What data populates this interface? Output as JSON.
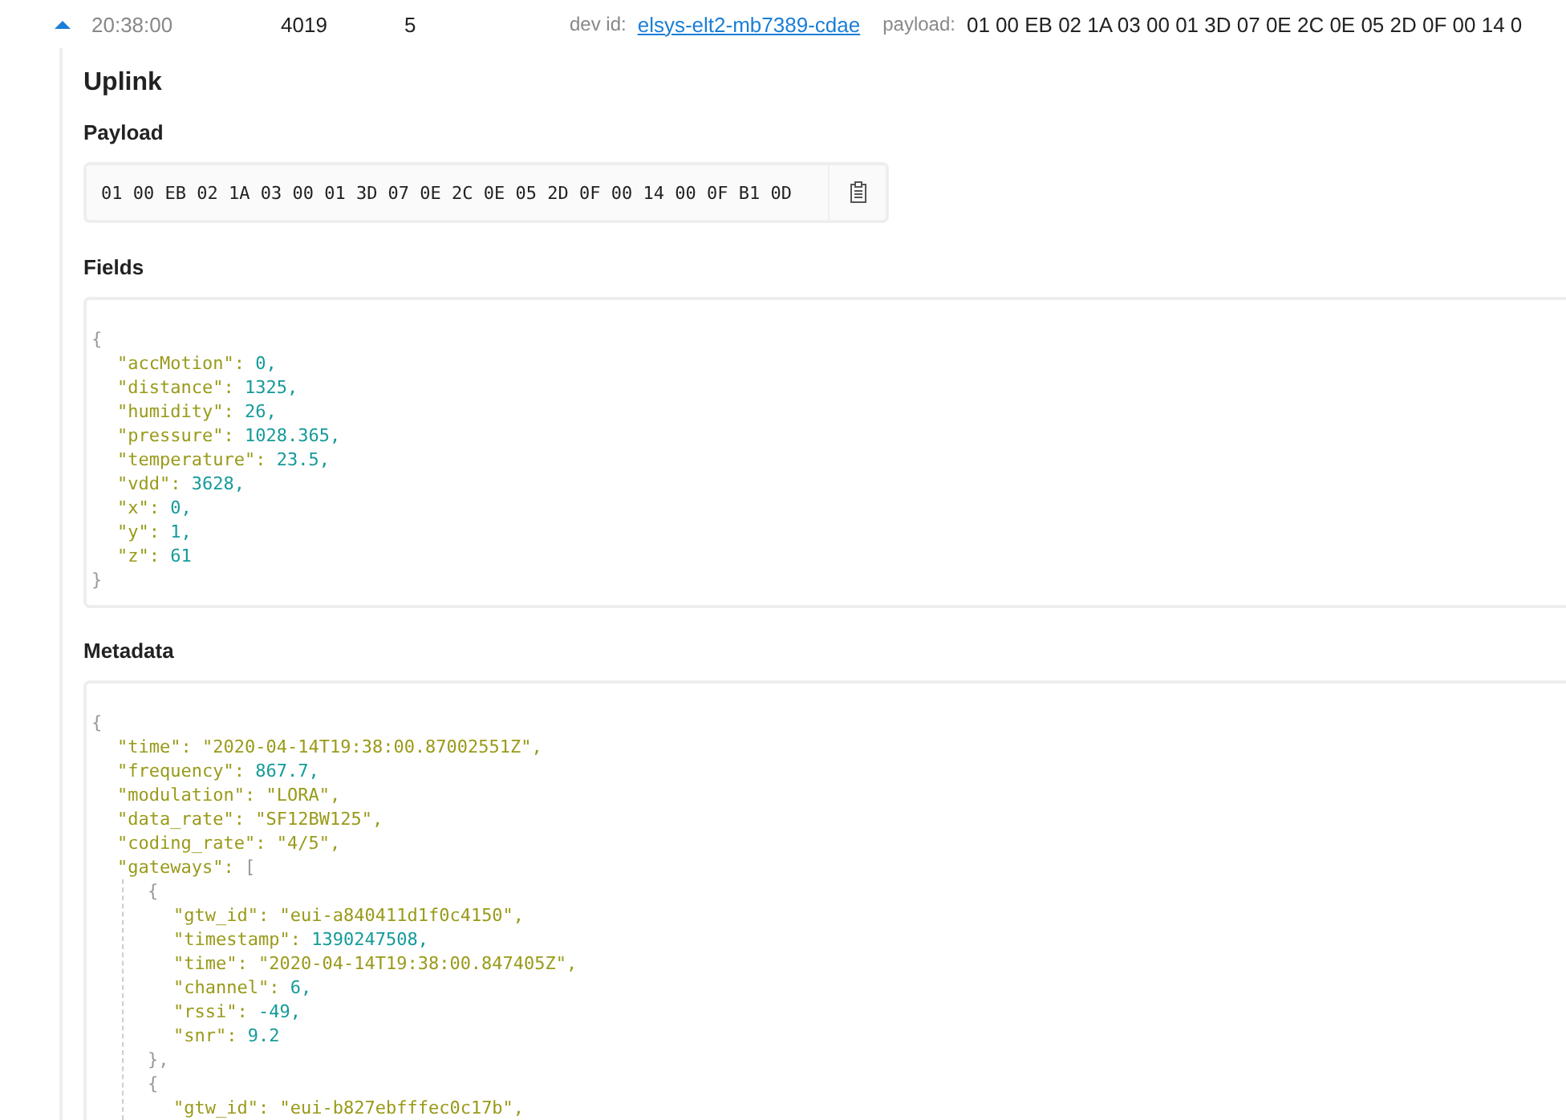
{
  "event": {
    "expanded": true,
    "time": "20:38:00",
    "counter": "4019",
    "port": "5",
    "dev_id_label": "dev id:",
    "dev_id": "elsys-elt2-mb7389-cdae",
    "payload_label": "payload:",
    "payload": "01 00 EB 02 1A 03 00 01 3D 07 0E 2C 0E 05 2D 0F 00 14 0"
  },
  "detail": {
    "title": "Uplink",
    "payload": {
      "label": "Payload",
      "value": "01 00 EB 02 1A 03 00 01 3D 07 0E 2C 0E 05 2D 0F 00 14 00 0F B1 0D"
    },
    "fields": {
      "label": "Fields",
      "json": {
        "open": "{",
        "close": "}",
        "entries": [
          {
            "key": "\"accMotion\":",
            "value": "0,",
            "kind": "number"
          },
          {
            "key": "\"distance\":",
            "value": "1325,",
            "kind": "number"
          },
          {
            "key": "\"humidity\":",
            "value": "26,",
            "kind": "number"
          },
          {
            "key": "\"pressure\":",
            "value": "1028.365,",
            "kind": "number"
          },
          {
            "key": "\"temperature\":",
            "value": "23.5,",
            "kind": "number"
          },
          {
            "key": "\"vdd\":",
            "value": "3628,",
            "kind": "number"
          },
          {
            "key": "\"x\":",
            "value": "0,",
            "kind": "number"
          },
          {
            "key": "\"y\":",
            "value": "1,",
            "kind": "number"
          },
          {
            "key": "\"z\":",
            "value": "61",
            "kind": "number"
          }
        ]
      }
    },
    "metadata": {
      "label": "Metadata",
      "json": {
        "open": "{",
        "entries": [
          {
            "key": "\"time\":",
            "value": "\"2020-04-14T19:38:00.87002551Z\",",
            "kind": "string"
          },
          {
            "key": "\"frequency\":",
            "value": "867.7,",
            "kind": "number"
          },
          {
            "key": "\"modulation\":",
            "value": "\"LORA\",",
            "kind": "string"
          },
          {
            "key": "\"data_rate\":",
            "value": "\"SF12BW125\",",
            "kind": "string"
          },
          {
            "key": "\"coding_rate\":",
            "value": "\"4/5\",",
            "kind": "string"
          },
          {
            "key": "\"gateways\":",
            "open": "[",
            "children": [
              {
                "open": "{",
                "close": "},",
                "entries": [
                  {
                    "key": "\"gtw_id\":",
                    "value": "\"eui-a840411d1f0c4150\",",
                    "kind": "string"
                  },
                  {
                    "key": "\"timestamp\":",
                    "value": "1390247508,",
                    "kind": "number"
                  },
                  {
                    "key": "\"time\":",
                    "value": "\"2020-04-14T19:38:00.847405Z\",",
                    "kind": "string"
                  },
                  {
                    "key": "\"channel\":",
                    "value": "6,",
                    "kind": "number"
                  },
                  {
                    "key": "\"rssi\":",
                    "value": "-49,",
                    "kind": "number"
                  },
                  {
                    "key": "\"snr\":",
                    "value": "9.2",
                    "kind": "number"
                  }
                ]
              },
              {
                "open": "{",
                "entries": [
                  {
                    "key": "\"gtw_id\":",
                    "value": "\"eui-b827ebfffec0c17b\",",
                    "kind": "string"
                  }
                ]
              }
            ]
          }
        ]
      }
    }
  }
}
